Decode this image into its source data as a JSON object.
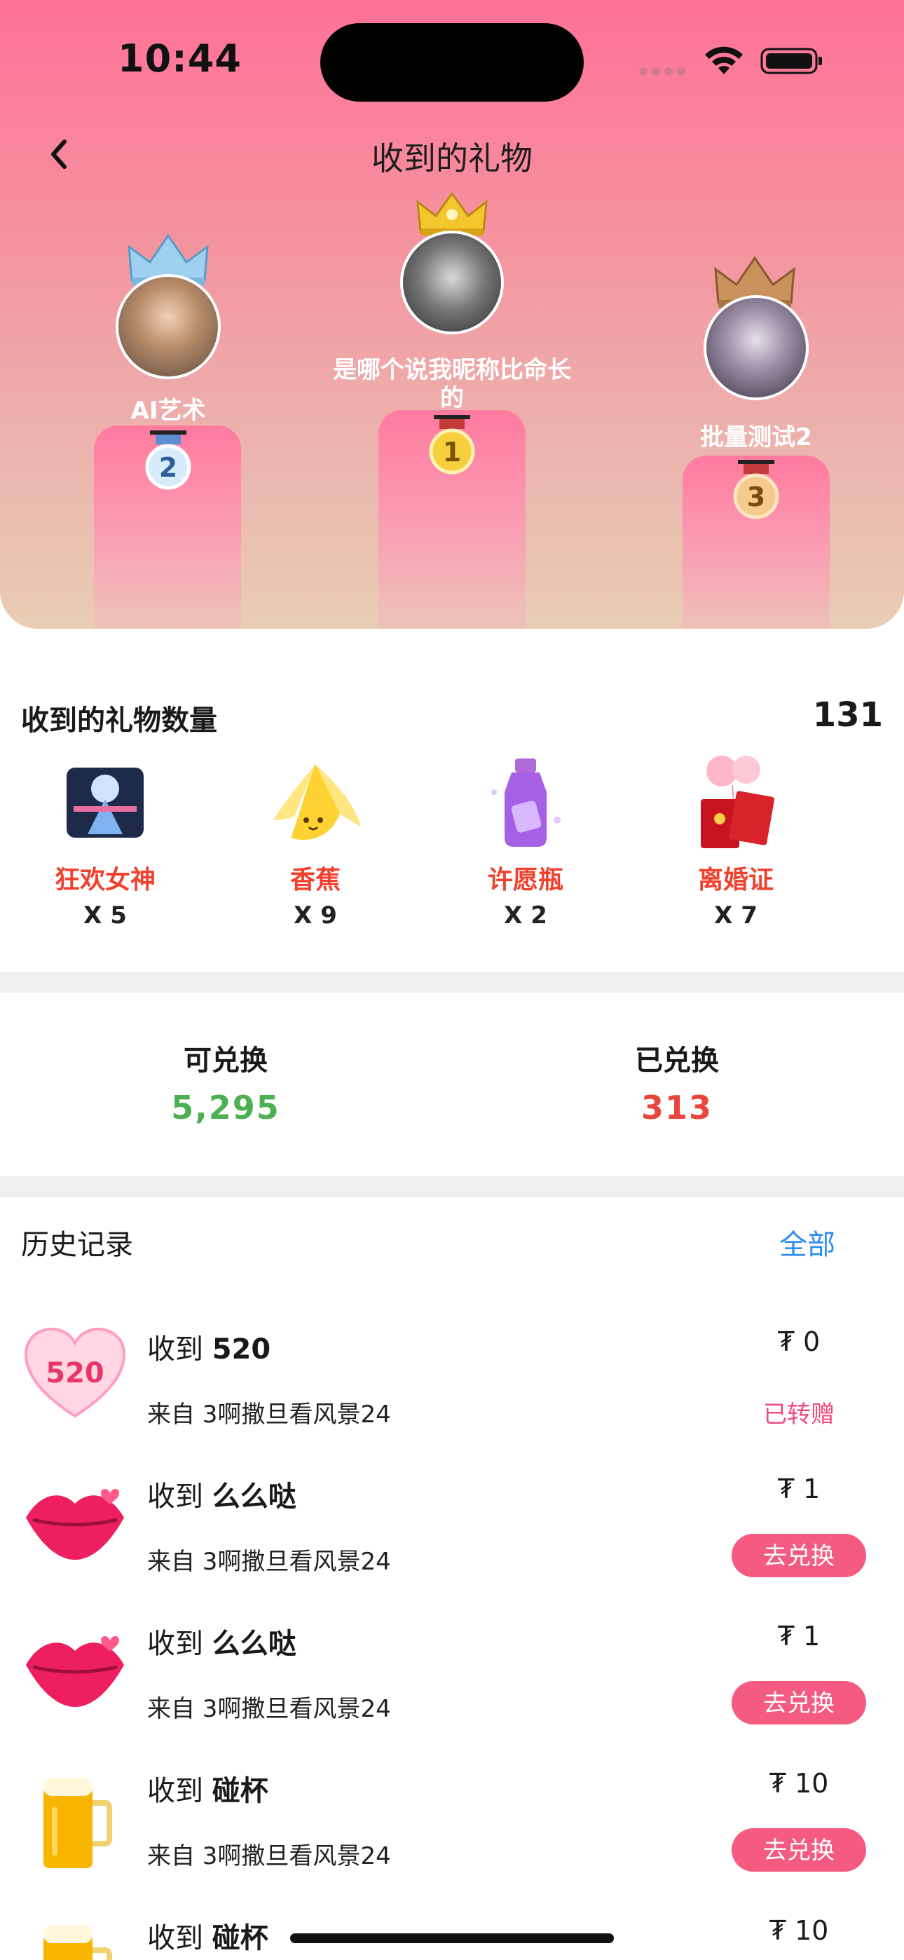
{
  "status_bar": {
    "time": "10:44"
  },
  "header": {
    "title": "收到的礼物"
  },
  "podium": [
    {
      "rank": "1",
      "name": "是哪个说我昵称比命长的"
    },
    {
      "rank": "2",
      "name": "AI艺术"
    },
    {
      "rank": "3",
      "name": "批量测试2"
    }
  ],
  "gift_summary": {
    "title": "收到的礼物数量",
    "total": "131",
    "gifts": [
      {
        "name": "狂欢女神",
        "qty": "X 5",
        "icon": "goddess-gift-icon"
      },
      {
        "name": "香蕉",
        "qty": "X 9",
        "icon": "banana-gift-icon"
      },
      {
        "name": "许愿瓶",
        "qty": "X 2",
        "icon": "wish-bottle-gift-icon"
      },
      {
        "name": "离婚证",
        "qty": "X 7",
        "icon": "divorce-certificate-gift-icon"
      }
    ]
  },
  "exchange": {
    "available_label": "可兑换",
    "available_value": "5,295",
    "exchanged_label": "已兑换",
    "exchanged_value": "313",
    "colors": {
      "available": "#4caf50",
      "exchanged": "#e8453c"
    }
  },
  "history": {
    "title": "历史记录",
    "filter_label": "全部",
    "received_prefix": "收到",
    "rows": [
      {
        "gift": "520",
        "from": "来自 3啊撒旦看风景24",
        "price": "₮ 0",
        "status": "已转赠",
        "icon": "heart-520-icon"
      },
      {
        "gift": "么么哒",
        "from": "来自 3啊撒旦看风景24",
        "price": "₮ 1",
        "action": "去兑换",
        "icon": "lips-icon"
      },
      {
        "gift": "么么哒",
        "from": "来自 3啊撒旦看风景24",
        "price": "₮ 1",
        "action": "去兑换",
        "icon": "lips-icon"
      },
      {
        "gift": "碰杯",
        "from": "来自 3啊撒旦看风景24",
        "price": "₮ 10",
        "action": "去兑换",
        "icon": "beer-mug-icon"
      },
      {
        "gift": "碰杯",
        "price": "₮ 10",
        "icon": "beer-mug-icon"
      }
    ]
  }
}
